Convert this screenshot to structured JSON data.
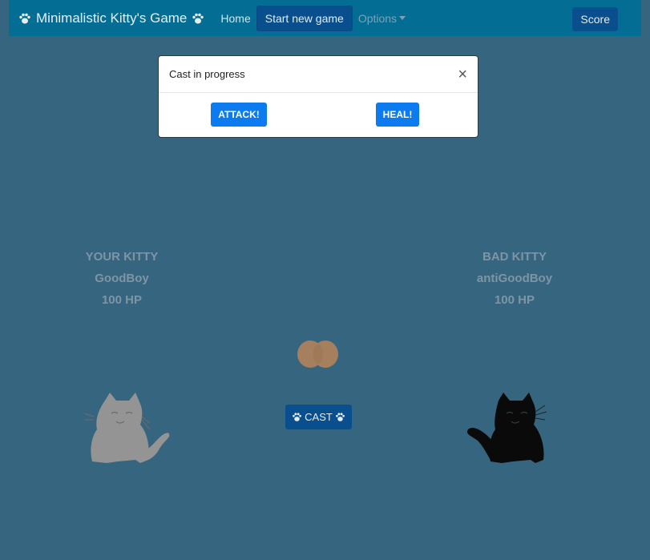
{
  "navbar": {
    "brand": "Minimalistic Kitty's Game",
    "home": "Home",
    "new_game": "Start new game",
    "options": "Options",
    "score": "Score"
  },
  "modal": {
    "title": "Cast in progress",
    "close": "×",
    "attack": "ATTACK!",
    "heal": "HEAL!"
  },
  "player": {
    "heading": "YOUR KITTY",
    "name": "GoodBoy",
    "hp": "100 HP"
  },
  "enemy": {
    "heading": "BAD KITTY",
    "name": "antiGoodBoy",
    "hp": "100 HP"
  },
  "cast_label": "CAST",
  "colors": {
    "background": "#36657f",
    "navbar": "#036d94",
    "primary": "#0d7bf0",
    "orb": "#a57f5e"
  }
}
